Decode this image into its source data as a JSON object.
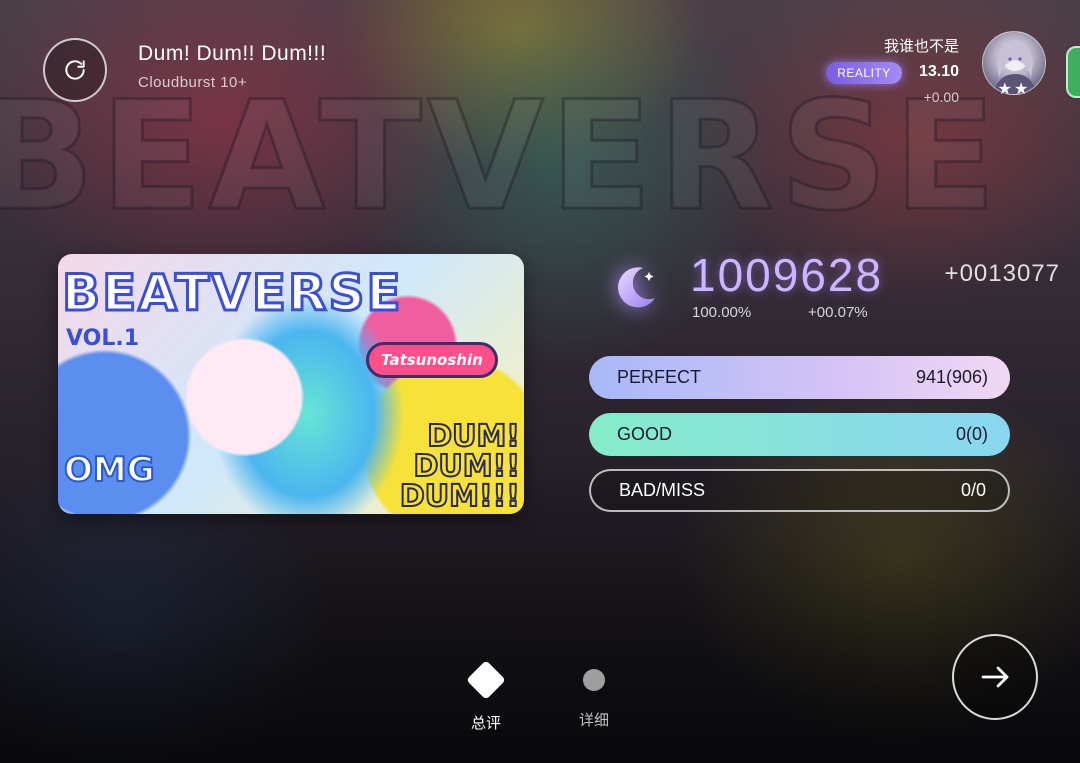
{
  "header": {
    "song_title": "Dum! Dum!! Dum!!!",
    "difficulty": "Cloudburst 10+"
  },
  "player": {
    "name": "我谁也不是",
    "rank_badge": "REALITY",
    "rks": "13.10",
    "rks_delta": "+0.00",
    "avatar_stars": "★★"
  },
  "cover": {
    "title": "BEATVERSE",
    "vol": "VOL.1",
    "artist": "Tatsunoshin",
    "dum_text": "DUM!\nDUM!!\nDUM!!!",
    "omg_text": "OMG"
  },
  "result": {
    "score": "1009628",
    "score_delta": "+0013077",
    "accuracy": "100.00%",
    "accuracy_delta": "+00.07%",
    "judgements": [
      {
        "label": "PERFECT",
        "value": "941(906)"
      },
      {
        "label": "GOOD",
        "value": "0(0)"
      },
      {
        "label": "BAD/MISS",
        "value": "0/0"
      }
    ]
  },
  "nav": {
    "summary_label": "总评",
    "detail_label": "详细"
  },
  "colors": {
    "score": "#cbb5ff",
    "perfect_bar": "#a7b9f7",
    "good_bar": "#86ecc9",
    "rank_badge": "#7a5de0"
  },
  "icons": {
    "retry": "refresh-icon",
    "grade": "crescent-moon-icon",
    "next": "arrow-right-icon"
  }
}
